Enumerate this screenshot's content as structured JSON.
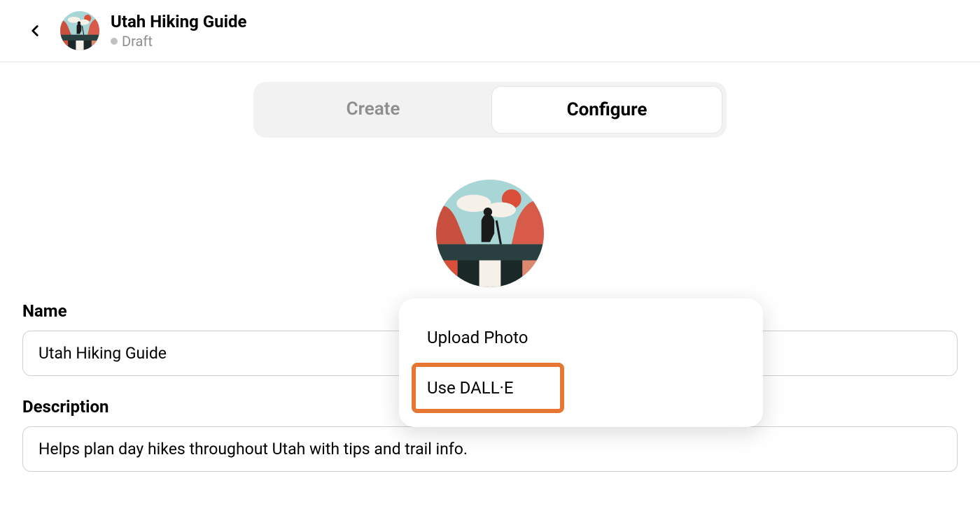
{
  "header": {
    "title": "Utah Hiking Guide",
    "status": "Draft"
  },
  "tabs": {
    "create": "Create",
    "configure": "Configure"
  },
  "avatarMenu": {
    "upload": "Upload Photo",
    "dalle": "Use DALL·E"
  },
  "form": {
    "nameLabel": "Name",
    "nameValue": "Utah Hiking Guide",
    "descriptionLabel": "Description",
    "descriptionValue": "Helps plan day hikes throughout Utah with tips and trail info."
  }
}
